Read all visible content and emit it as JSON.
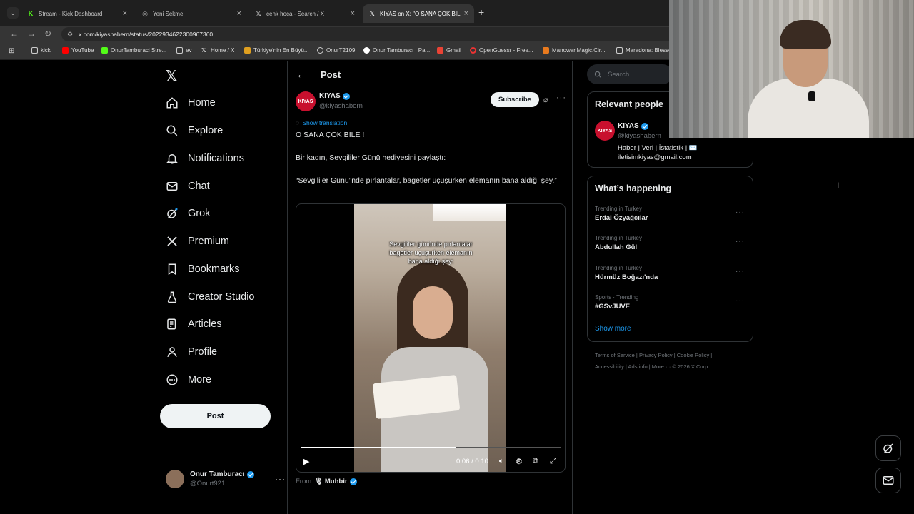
{
  "browser": {
    "tabs": [
      {
        "title": "Stream - Kick Dashboard",
        "active": false
      },
      {
        "title": "Yeni Sekme",
        "active": false
      },
      {
        "title": "cenk hoca - Search / X",
        "active": false
      },
      {
        "title": "KIYAS on X: \"O SANA ÇOK BİLE",
        "active": true
      }
    ],
    "url": "x.com/kiyashabern/status/2022934622300967360",
    "bookmarks": [
      "kick",
      "YouTube",
      "OnurTamburaci Stre...",
      "ev",
      "Home / X",
      "Türkiye'nin En Büyü...",
      "OnurT2109",
      "Onur Tamburacı | Pa...",
      "Gmail",
      "OpenGuessr - Free...",
      "Manowar.Magic.Cir...",
      "Maradona: Blesse"
    ]
  },
  "nav": {
    "home": "Home",
    "explore": "Explore",
    "notifications": "Notifications",
    "chat": "Chat",
    "grok": "Grok",
    "premium": "Premium",
    "bookmarks": "Bookmarks",
    "creator_studio": "Creator Studio",
    "articles": "Articles",
    "profile": "Profile",
    "more": "More",
    "post_button": "Post"
  },
  "account": {
    "name": "Onur Tamburacı",
    "handle": "@Onurt921"
  },
  "post": {
    "header": "Post",
    "author_name": "KIYAS",
    "author_handle": "@kiyashabern",
    "avatar_text": "KIYAS",
    "subscribe": "Subscribe",
    "show_translation": "Show translation",
    "line1": "O SANA ÇOK BİLE !",
    "line2": "Bir kadın, Sevgililer Günü hediyesini paylaştı:",
    "line3": "“Sevgililer Günü”nde pırlantalar, bagetler uçuşurken elemanın bana aldığı şey.”",
    "video_caption": "Sevgililer gününde pırlantalar bagetler uçuşurken elemanın bana aldığı şey:",
    "video_time": "0:06 / 0:10",
    "video_progress": 0.6,
    "from_label": "From",
    "from_source": "Muhbir"
  },
  "search": {
    "placeholder": "Search"
  },
  "relevant": {
    "title": "Relevant people",
    "name": "KIYAS",
    "handle": "@kiyashabern",
    "bio1": "Haber | Veri | İstatistik | ✉️",
    "bio2": "iletisimkiyas@gmail.com"
  },
  "happening": {
    "title": "What’s happening",
    "trends": [
      {
        "context": "Trending in Turkey",
        "name": "Erdal Özyağcılar"
      },
      {
        "context": "Trending in Turkey",
        "name": "Abdullah Gül"
      },
      {
        "context": "Trending in Turkey",
        "name": "Hürmüz Boğazı'nda"
      },
      {
        "context": "Sports · Trending",
        "name": "#GSvJUVE"
      }
    ],
    "show_more": "Show more"
  },
  "footer": {
    "line1": "Terms of Service  |  Privacy Policy  |  Cookie Policy  |",
    "line2": "Accessibility  |  Ads info  |  More ···  © 2026 X Corp."
  },
  "colors": {
    "accent": "#1d9bf0",
    "background": "#000000",
    "border": "#2f3336",
    "muted": "#71767b"
  }
}
